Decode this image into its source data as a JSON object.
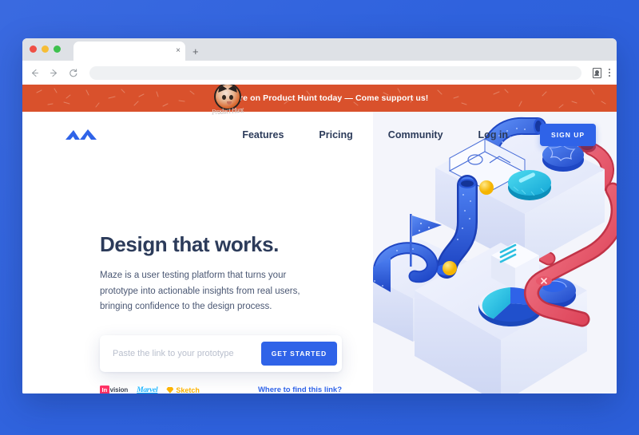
{
  "browser": {
    "tab_title": "",
    "tab_close_label": "×",
    "new_tab_label": "+",
    "back_icon": "back-arrow-icon",
    "forward_icon": "forward-arrow-icon",
    "reload_icon": "reload-icon",
    "url_value": "",
    "url_placeholder": "",
    "profile_icon": "profile-icon",
    "menu_icon": "kebab-menu-icon",
    "traffic_lights": [
      "close-red",
      "minimize-yellow",
      "maximize-green"
    ]
  },
  "announcement": {
    "text": "We're on Product Hunt today — Come support us!",
    "badge_word": "Product Hunt",
    "background_color": "#d9512c",
    "text_color": "#ffffff"
  },
  "nav": {
    "logo_name": "maze-logo",
    "logo_color": "#2f63e8",
    "links": [
      {
        "label": "Features"
      },
      {
        "label": "Pricing"
      },
      {
        "label": "Community"
      },
      {
        "label": "Log in"
      }
    ],
    "signup_label": "SIGN UP",
    "signup_color": "#2f63e8"
  },
  "hero": {
    "heading": "Design that works.",
    "paragraph": "Maze is a user testing platform that turns your prototype into actionable insights from real users, bringing confidence to the design process.",
    "input_placeholder": "Paste the link to your prototype",
    "input_value": "",
    "cta_label": "GET STARTED",
    "find_link_label": "Where to find this link?",
    "tools": [
      {
        "name": "InVision",
        "mark": "In",
        "word": "vision",
        "color": "#ff3366"
      },
      {
        "name": "Marvel",
        "word": "Marvel",
        "color": "#1fb6ff"
      },
      {
        "name": "Sketch",
        "word": "Sketch",
        "color": "#fdb300"
      }
    ]
  },
  "illustration": {
    "name": "isometric-3d-maze-illustration",
    "palette": {
      "blue": "#2f63e8",
      "light_blue": "#2bc4e8",
      "red": "#e8566a",
      "yellow": "#ffd233",
      "platform": "#e7ebfa"
    }
  },
  "page_background": {
    "color_start": "#3a6ae0",
    "color_end": "#2c5fd9"
  }
}
